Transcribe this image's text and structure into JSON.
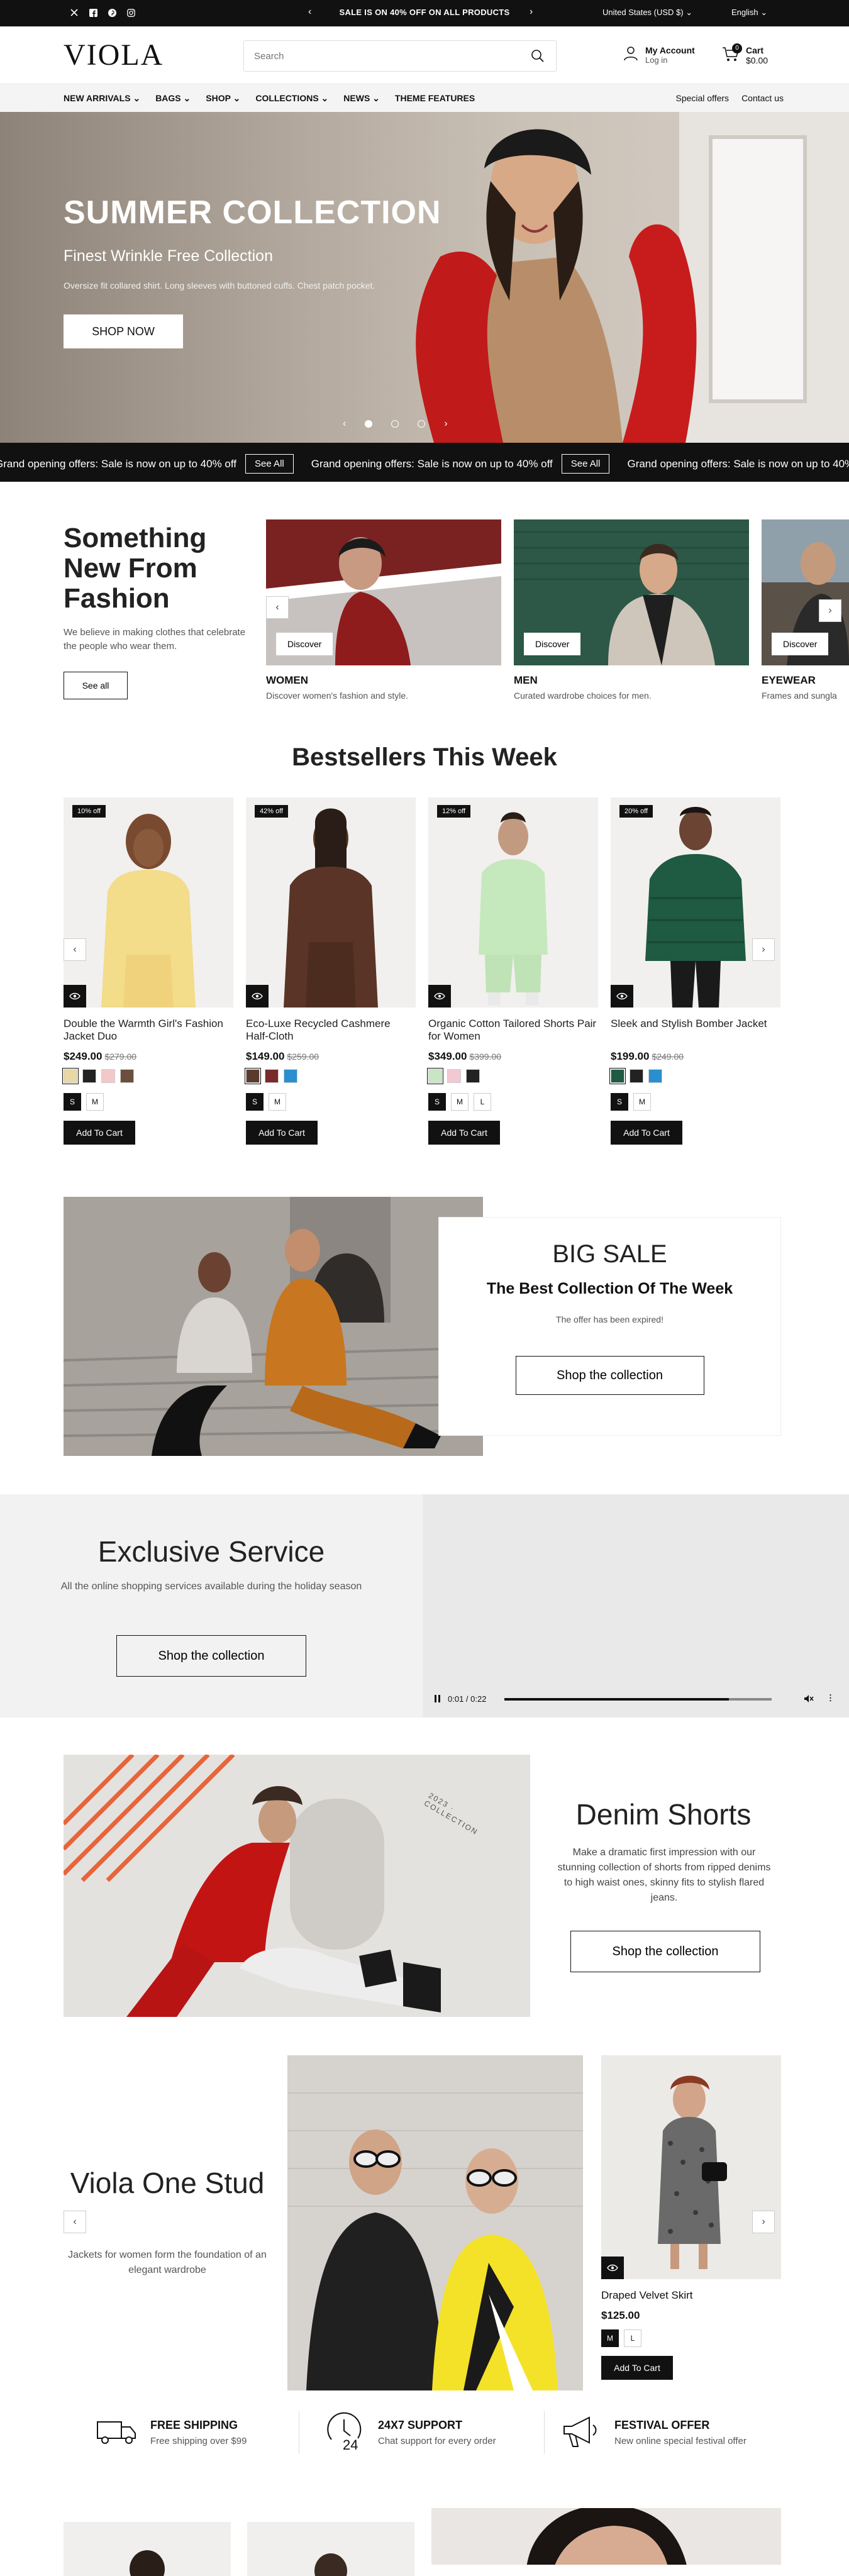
{
  "topbar": {
    "promo": "SALE IS ON 40% OFF ON ALL PRODUCTS",
    "currency": "United States (USD $)",
    "language": "English",
    "social_icons": [
      "x-icon",
      "facebook-icon",
      "pinterest-icon",
      "instagram-icon"
    ]
  },
  "header": {
    "logo": "VIOLA",
    "search_placeholder": "Search",
    "account_title": "My Account",
    "account_sub": "Log in",
    "cart_title": "Cart",
    "cart_total": "$0.00",
    "cart_count": "0"
  },
  "nav": {
    "items": [
      "NEW ARRIVALS",
      "BAGS",
      "SHOP",
      "COLLECTIONS",
      "NEWS",
      "THEME FEATURES"
    ],
    "right": [
      "Special offers",
      "Contact us"
    ]
  },
  "hero": {
    "title": "SUMMER COLLECTION",
    "subtitle": "Finest Wrinkle Free Collection",
    "desc": "Oversize fit collared shirt. Long sleeves with buttoned cuffs. Chest patch pocket.",
    "button": "SHOP NOW"
  },
  "marquee": {
    "text": "Grand opening offers: Sale is now on up to 40% off",
    "button": "See All"
  },
  "fashion": {
    "title": "Something New From Fashion",
    "desc": "We believe in making clothes that celebrate the people who wear them.",
    "button": "See all",
    "discover": "Discover",
    "categories": [
      {
        "name": "WOMEN",
        "desc": "Discover women's fashion and style."
      },
      {
        "name": "MEN",
        "desc": "Curated wardrobe choices for men."
      },
      {
        "name": "EYEWEAR",
        "desc": "Frames and sungla"
      }
    ]
  },
  "bestsellers": {
    "title": "Bestsellers This Week",
    "add_to_cart": "Add To Cart",
    "products": [
      {
        "badge": "10% off",
        "name": "Double the Warmth Girl's Fashion Jacket Duo",
        "price": "$249.00",
        "old": "$279.00",
        "swatches": [
          "#e9d8a6",
          "#222222",
          "#f2c9c9",
          "#6b4e3d"
        ],
        "sizes": [
          "S",
          "M"
        ]
      },
      {
        "badge": "42% off",
        "name": "Eco-Luxe Recycled Cashmere Half-Cloth",
        "price": "$149.00",
        "old": "$259.00",
        "swatches": [
          "#5a3a2c",
          "#7a2a2a",
          "#2a8fd0"
        ],
        "sizes": [
          "S",
          "M"
        ]
      },
      {
        "badge": "12% off",
        "name": "Organic Cotton Tailored Shorts Pair for Women",
        "price": "$349.00",
        "old": "$399.00",
        "swatches": [
          "#c9e6c4",
          "#f2c9d2",
          "#222222"
        ],
        "sizes": [
          "S",
          "M",
          "L"
        ]
      },
      {
        "badge": "20% off",
        "name": "Sleek and Stylish Bomber Jacket",
        "price": "$199.00",
        "old": "$249.00",
        "swatches": [
          "#1f5a43",
          "#222222",
          "#2a8fd0"
        ],
        "sizes": [
          "S",
          "M"
        ]
      }
    ]
  },
  "sale": {
    "title": "BIG SALE",
    "subtitle": "The Best Collection Of The Week",
    "note": "The offer has been expired!",
    "button": "Shop the collection"
  },
  "exclusive": {
    "title": "Exclusive Service",
    "desc": "All the online shopping services available during the holiday season",
    "button": "Shop the collection",
    "time": "0:01 / 0:22",
    "progress": 0.84
  },
  "denim": {
    "title": "Denim Shorts",
    "desc": "Make a dramatic first impression with our stunning collection of shorts from ripped denims to high waist ones, skinny fits to stylish flared jeans.",
    "button": "Shop the collection",
    "stamp": "2023 · COLLECTION"
  },
  "viola": {
    "title": "Viola One Stud",
    "desc": "Jackets for women form the foundation of an elegant wardrobe",
    "product": {
      "name": "Draped Velvet Skirt",
      "price": "$125.00",
      "sizes": [
        "M",
        "L"
      ],
      "button": "Add To Cart"
    }
  },
  "features": [
    {
      "icon": "truck-icon",
      "title": "FREE SHIPPING",
      "desc": "Free shipping over $99"
    },
    {
      "icon": "support-24-icon",
      "title": "24X7 SUPPORT",
      "desc": "Chat support for every order"
    },
    {
      "icon": "megaphone-icon",
      "title": "FESTIVAL OFFER",
      "desc": "New online special festival offer"
    }
  ]
}
